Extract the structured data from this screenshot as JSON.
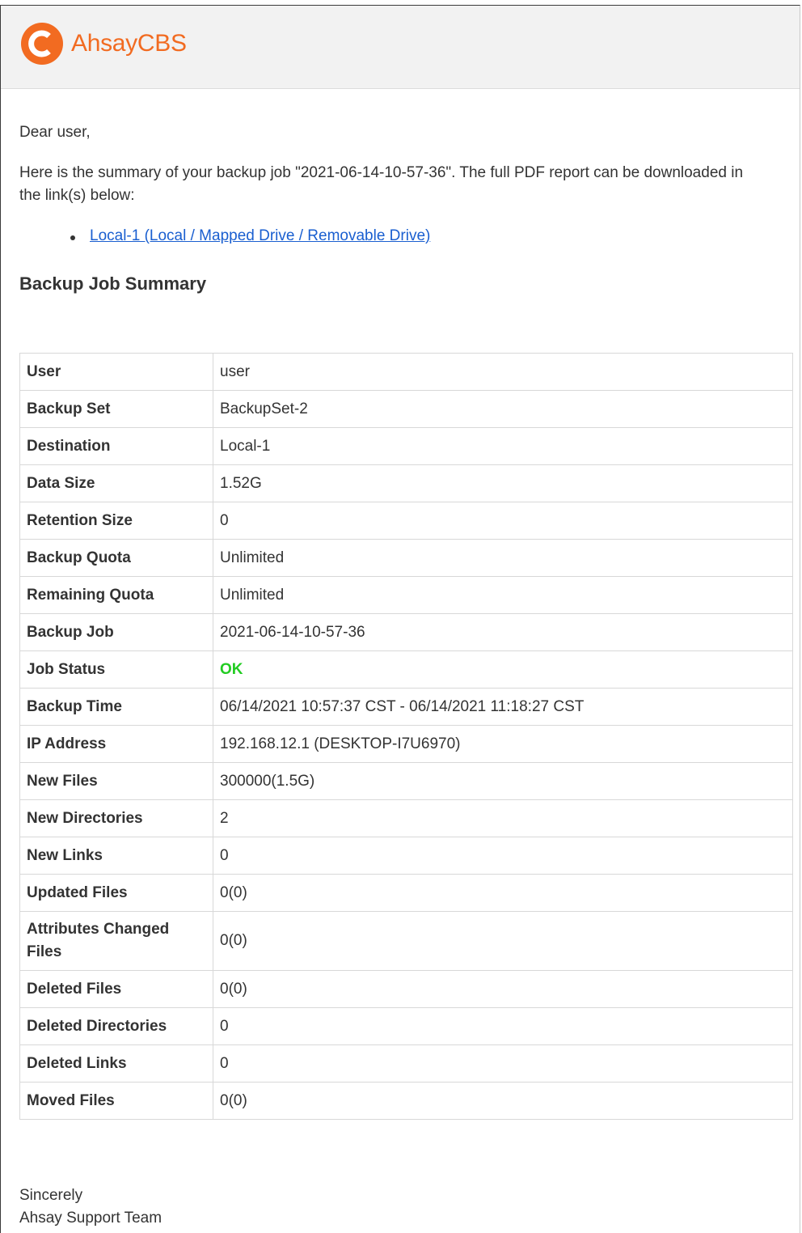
{
  "header": {
    "brand": "AhsayCBS",
    "brand_color": "#f26b21",
    "logo_icon": "ahsay-logo-icon"
  },
  "email": {
    "greeting": "Dear user,",
    "intro": "Here is the summary of your backup job \"2021-06-14-10-57-36\". The full PDF report can be downloaded in the link(s) below:",
    "links": [
      {
        "label": "Local-1 (Local / Mapped Drive / Removable Drive)"
      }
    ],
    "section_title": "Backup Job Summary",
    "summary_rows": [
      {
        "label": "User",
        "value": "user"
      },
      {
        "label": "Backup Set",
        "value": "BackupSet-2"
      },
      {
        "label": "Destination",
        "value": "Local-1"
      },
      {
        "label": "Data Size",
        "value": "1.52G"
      },
      {
        "label": "Retention Size",
        "value": "0"
      },
      {
        "label": "Backup Quota",
        "value": "Unlimited"
      },
      {
        "label": "Remaining Quota",
        "value": "Unlimited"
      },
      {
        "label": "Backup Job",
        "value": "2021-06-14-10-57-36"
      },
      {
        "label": "Job Status",
        "value": "OK"
      },
      {
        "label": "Backup Time",
        "value": "06/14/2021 10:57:37 CST - 06/14/2021 11:18:27 CST"
      },
      {
        "label": "IP Address",
        "value": "192.168.12.1 (DESKTOP-I7U6970)"
      },
      {
        "label": "New Files",
        "value": "300000(1.5G)"
      },
      {
        "label": "New Directories",
        "value": "2"
      },
      {
        "label": "New Links",
        "value": "0"
      },
      {
        "label": "Updated Files",
        "value": "0(0)"
      },
      {
        "label": "Attributes Changed Files",
        "value": "0(0)"
      },
      {
        "label": "Deleted Files",
        "value": "0(0)"
      },
      {
        "label": "Deleted Directories",
        "value": "0"
      },
      {
        "label": "Deleted Links",
        "value": "0"
      },
      {
        "label": "Moved Files",
        "value": "0(0)"
      }
    ],
    "status_ok_color": "#22cc22",
    "link_color": "#1a5fd0",
    "closing_line1": "Sincerely",
    "closing_line2": "Ahsay Support Team"
  }
}
